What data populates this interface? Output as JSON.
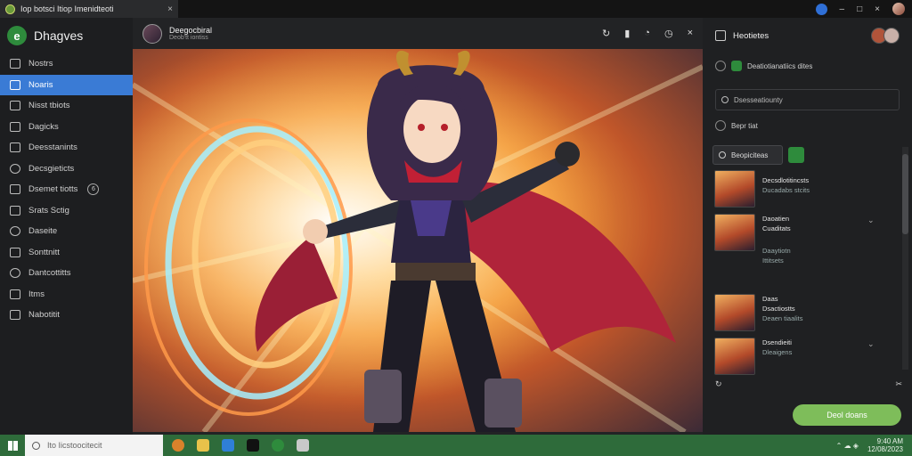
{
  "browser": {
    "tab_title": "Iop botsci Itiop Imenidteoti",
    "tab_close": "×",
    "controls": [
      "–",
      "□",
      "×"
    ]
  },
  "app": {
    "name": "Dhagves"
  },
  "sidebar": {
    "items": [
      {
        "label": "Nostrs",
        "active": false
      },
      {
        "label": "Noaris",
        "active": true
      },
      {
        "label": "Nisst tbiots",
        "active": false
      },
      {
        "label": "Dagicks",
        "active": false
      },
      {
        "label": "Deesstanints",
        "active": false
      },
      {
        "label": "Decsgieticts",
        "active": false
      },
      {
        "label": "Dsemet tiotts",
        "active": false,
        "badge": "6"
      },
      {
        "label": "Srats Sctig",
        "active": false
      },
      {
        "label": "Daseite",
        "active": false
      },
      {
        "label": "Sonttnitt",
        "active": false
      },
      {
        "label": "Dantcottitts",
        "active": false
      },
      {
        "label": "Itms",
        "active": false
      },
      {
        "label": "Nabotitit",
        "active": false
      }
    ]
  },
  "main": {
    "title": "Deegocbiral",
    "subtitle": "Deob'tt iontiss",
    "tools": [
      "↻",
      "▮",
      "◔",
      "◷",
      "×"
    ]
  },
  "right": {
    "header": "Heotietes",
    "line1": "Deatiotianatiics dites",
    "search_placeholder": "Dsesseatiounty",
    "section": "Bepr tiat",
    "filter_label": "Beopiciteas",
    "items": [
      {
        "title": "Decsdlotitincsts",
        "sub": "Ducadabs stcits"
      },
      {
        "title": "Daoatien",
        "sub": "Cuaditats",
        "meta1": "Daaytiotn",
        "meta2": "Ittitsets"
      },
      {
        "title": "Daas",
        "sub": "Dsactiostts",
        "meta1": "Deaen tiaalits"
      },
      {
        "title": "Dsendieiti",
        "sub": "Dleaigens"
      }
    ],
    "footer_left": "↻",
    "footer_right": "✂",
    "primary_button": "Deol doans"
  },
  "taskbar": {
    "search_placeholder": "Ito Iicstoocitecit",
    "time": "9:40 AM",
    "date": "12/08/2023"
  },
  "colors": {
    "accent": "#3a7bd5",
    "brand": "#2e8b3c",
    "primary_button": "#7ebd5a",
    "taskbar": "#2e6b3a"
  }
}
